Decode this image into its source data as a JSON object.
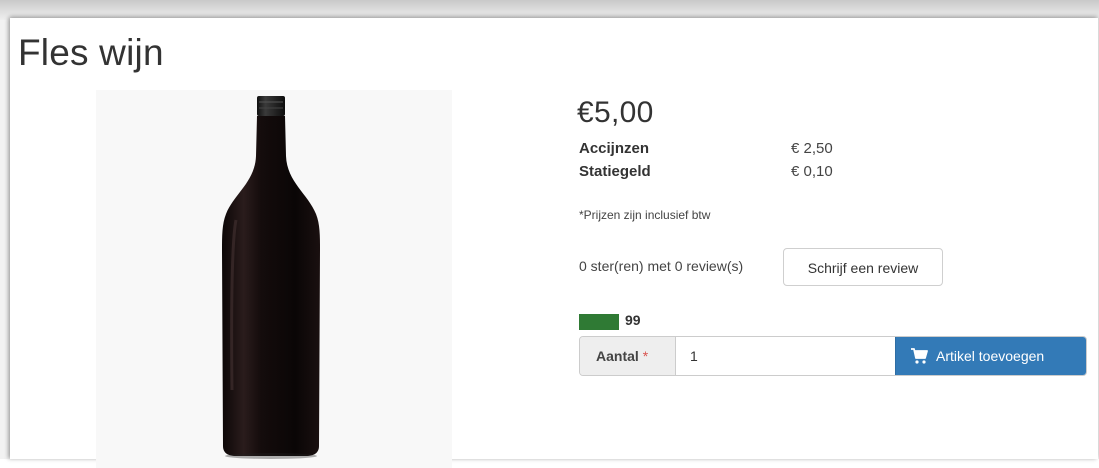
{
  "product": {
    "title": "Fles wijn",
    "image_name": "wine-bottle",
    "price": "€5,00",
    "fees": [
      {
        "label": "Accijnzen",
        "value": "€ 2,50"
      },
      {
        "label": "Statiegeld",
        "value": "€ 0,10"
      }
    ],
    "vat_note": "*Prijzen zijn inclusief btw"
  },
  "reviews": {
    "summary": "0 ster(ren) met 0 review(s)",
    "write_button": "Schrijf een review"
  },
  "stock": {
    "count": "99",
    "indicator_color": "#2f7a34"
  },
  "purchase": {
    "quantity_label": "Aantal",
    "required_marker": "*",
    "quantity_value": "1",
    "add_button": "Artikel toevoegen",
    "add_button_icon": "cart-icon",
    "accent_color": "#337ab7"
  }
}
